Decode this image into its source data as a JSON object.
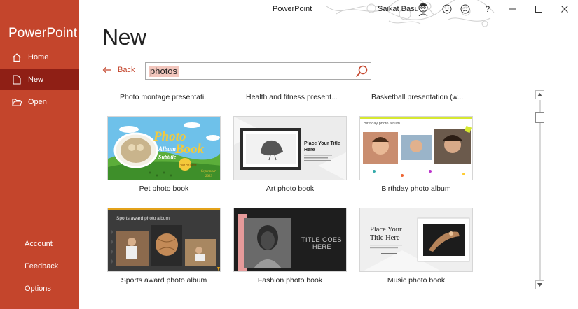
{
  "sidebar": {
    "brand": "PowerPoint",
    "nav": [
      {
        "label": "Home",
        "icon": "home-icon"
      },
      {
        "label": "New",
        "icon": "new-document-icon",
        "active": true
      },
      {
        "label": "Open",
        "icon": "folder-open-icon"
      }
    ],
    "bottom": [
      {
        "label": "Account"
      },
      {
        "label": "Feedback"
      },
      {
        "label": "Options"
      }
    ]
  },
  "titlebar": {
    "app_title": "PowerPoint",
    "user_name": "Saikat Basu",
    "icons": [
      "smiley-icon",
      "frown-icon",
      "help-icon",
      "minimize-icon",
      "maximize-icon",
      "close-icon"
    ],
    "help_glyph": "?"
  },
  "main": {
    "heading": "New",
    "back_label": "Back",
    "search": {
      "value": "photos"
    },
    "top_row_labels": [
      "Photo montage presentati...",
      "Health and fitness present...",
      "Basketball presentation (w..."
    ],
    "templates": [
      {
        "caption": "Pet photo book",
        "thumb_text": [
          "Photo",
          "Album",
          "Book",
          "Subtitle",
          "Your Pet Name",
          "September",
          "2023"
        ]
      },
      {
        "caption": "Art photo book",
        "thumb_text": [
          "Place Your Title",
          "Here"
        ]
      },
      {
        "caption": "Birthday photo album",
        "thumb_text": [
          "Birthday photo album"
        ]
      },
      {
        "caption": "Sports award photo album",
        "thumb_text": [
          "Sports award photo album"
        ]
      },
      {
        "caption": "Fashion photo book",
        "thumb_text": [
          "TITLE GOES",
          "HERE"
        ]
      },
      {
        "caption": "Music photo book",
        "thumb_text": [
          "Place Your",
          "Title Here"
        ]
      }
    ]
  },
  "colors": {
    "sidebar": "#c4452c",
    "sidebar_active": "#8f1f15",
    "accent": "#c4452c"
  }
}
